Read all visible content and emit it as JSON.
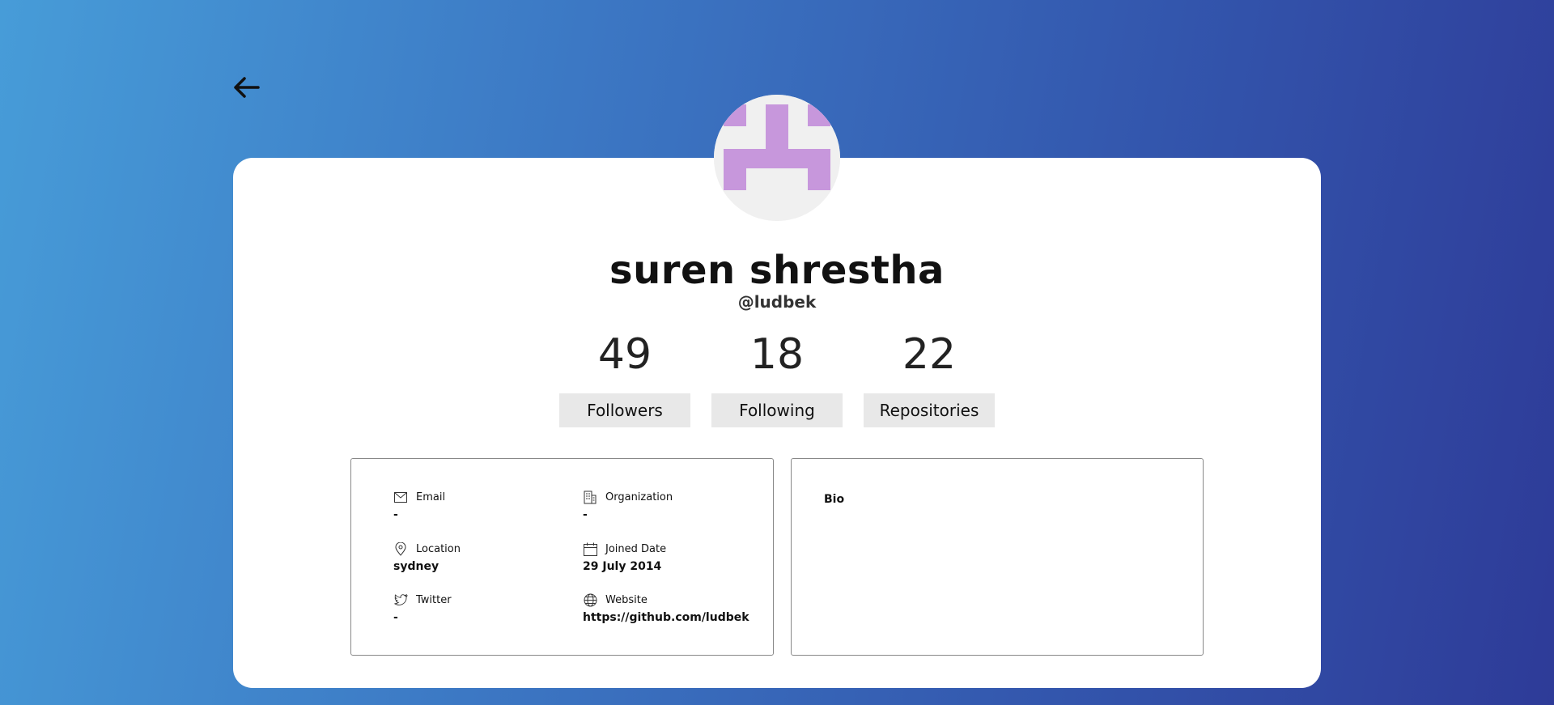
{
  "profile": {
    "name": "suren shrestha",
    "login": "@ludbek",
    "avatar_color": "#c797dc",
    "avatar_bg": "#f0f0f0"
  },
  "stats": [
    {
      "value": "49",
      "label": "Followers"
    },
    {
      "value": "18",
      "label": "Following"
    },
    {
      "value": "22",
      "label": "Repositories"
    }
  ],
  "info": {
    "email": {
      "label": "Email",
      "value": "-",
      "icon": "mail-icon"
    },
    "organization": {
      "label": "Organization",
      "value": "-",
      "icon": "building-icon"
    },
    "location": {
      "label": "Location",
      "value": "sydney",
      "icon": "location-pin-icon"
    },
    "joined": {
      "label": "Joined Date",
      "value": "29 July 2014",
      "icon": "calendar-icon"
    },
    "twitter": {
      "label": "Twitter",
      "value": "-",
      "icon": "twitter-icon"
    },
    "website": {
      "label": "Website",
      "value": "https://github.com/ludbek",
      "icon": "globe-icon"
    }
  },
  "bio": {
    "title": "Bio"
  },
  "nav": {
    "back_icon": "arrow-left-icon"
  }
}
